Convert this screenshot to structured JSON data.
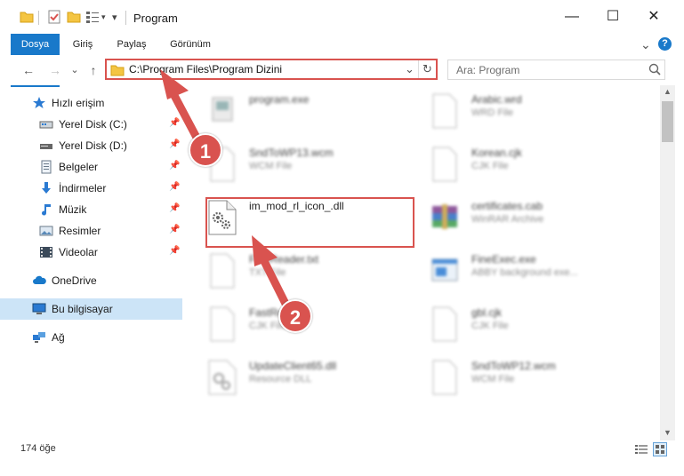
{
  "window": {
    "title": "Program",
    "minimize": "—",
    "maximize": "☐",
    "close": "✕"
  },
  "ribbon": {
    "tabs": [
      "Dosya",
      "Giriş",
      "Paylaş",
      "Görünüm"
    ],
    "expand": "⌄",
    "help": "?"
  },
  "address": {
    "path": "C:\\Program Files\\Program Dizini",
    "dropdown": "⌄",
    "refresh": "↻"
  },
  "search": {
    "placeholder": "Ara: Program"
  },
  "nav": {
    "back": "←",
    "forward": "→",
    "recent": "⌄",
    "up": "↑"
  },
  "sidebar": {
    "items": [
      {
        "label": "Hızlı erişim",
        "icon": "star-icon",
        "pinned": false
      },
      {
        "label": "Yerel Disk (C:)",
        "icon": "drive-icon",
        "pinned": true
      },
      {
        "label": "Yerel Disk (D:)",
        "icon": "drive-icon",
        "pinned": true
      },
      {
        "label": "Belgeler",
        "icon": "documents-icon",
        "pinned": true
      },
      {
        "label": "İndirmeler",
        "icon": "download-icon",
        "pinned": true
      },
      {
        "label": "Müzik",
        "icon": "music-icon",
        "pinned": true
      },
      {
        "label": "Resimler",
        "icon": "pictures-icon",
        "pinned": true
      },
      {
        "label": "Videolar",
        "icon": "videos-icon",
        "pinned": true
      },
      {
        "label": "OneDrive",
        "icon": "cloud-icon",
        "pinned": false
      },
      {
        "label": "Bu bilgisayar",
        "icon": "computer-icon",
        "pinned": false
      },
      {
        "label": "Ağ",
        "icon": "network-icon",
        "pinned": false
      }
    ],
    "pin_glyph": "📌"
  },
  "files": [
    {
      "name": "program.exe",
      "type": "",
      "icon": "exe-icon",
      "blurred": true
    },
    {
      "name": "Arabic.wrd",
      "type": "WRD File",
      "icon": "blank-file-icon",
      "blurred": true
    },
    {
      "name": "SndToWP13.wcm",
      "type": "WCM File",
      "icon": "blank-file-icon",
      "blurred": true
    },
    {
      "name": "Korean.cjk",
      "type": "CJK File",
      "icon": "blank-file-icon",
      "blurred": true
    },
    {
      "name": "im_mod_rl_icon_.dll",
      "type": "",
      "icon": "dll-gear-icon",
      "blurred": false
    },
    {
      "name": "certificates.cab",
      "type": "WinRAR Archive",
      "icon": "winrar-icon",
      "blurred": true
    },
    {
      "name": "FineReader.txt",
      "type": "TXT File",
      "icon": "blank-file-icon",
      "blurred": true
    },
    {
      "name": "FineExec.exe",
      "type": "ABBY background exe...",
      "icon": "app-window-icon",
      "blurred": true
    },
    {
      "name": "FastRe...",
      "type": "CJK File",
      "icon": "blank-file-icon",
      "blurred": true
    },
    {
      "name": "gbl.cjk",
      "type": "CJK File",
      "icon": "blank-file-icon",
      "blurred": true
    },
    {
      "name": "UpdateClient65.dll",
      "type": "Resource DLL",
      "icon": "dll-gear-icon",
      "blurred": true
    },
    {
      "name": "SndToWP12.wcm",
      "type": "WCM File",
      "icon": "blank-file-icon",
      "blurred": true
    }
  ],
  "status": {
    "count": "174 öğe"
  },
  "annotations": {
    "step1": "1",
    "step2": "2",
    "color": "#d9534f"
  },
  "colors": {
    "accent": "#1979ca",
    "selection": "#cce4f7",
    "highlight": "#d9534f"
  }
}
